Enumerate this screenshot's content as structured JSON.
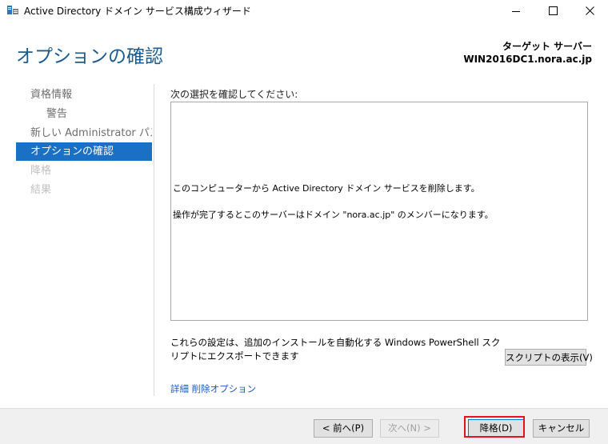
{
  "window": {
    "title": "Active Directory ドメイン サービス構成ウィザード",
    "icon": "server-wizard-icon",
    "minimize_icon": "minimize-icon",
    "maximize_icon": "maximize-icon",
    "close_icon": "close-icon"
  },
  "header": {
    "page_title": "オプションの確認",
    "target_label": "ターゲット サーバー",
    "target_server": "WIN2016DC1.nora.ac.jp"
  },
  "sidebar": {
    "items": [
      {
        "label": "資格情報",
        "state": "normal"
      },
      {
        "label": "警告",
        "state": "normal"
      },
      {
        "label": "新しい Administrator パス...",
        "state": "normal"
      },
      {
        "label": "オプションの確認",
        "state": "active"
      },
      {
        "label": "降格",
        "state": "disabled"
      },
      {
        "label": "結果",
        "state": "disabled"
      }
    ]
  },
  "main": {
    "review_label": "次の選択を確認してください:",
    "summary_lines": [
      "このコンピューターから Active Directory ドメイン サービスを削除します。",
      "操作が完了するとこのサーバーはドメイン \"nora.ac.jp\" のメンバーになります。"
    ],
    "powershell_note": "これらの設定は、追加のインストールを自動化する Windows PowerShell スクリプトにエクスポートできます",
    "view_script_button": "スクリプトの表示(V)",
    "details_link": "詳細 削除オプション"
  },
  "footer": {
    "prev_button": "< 前へ(P)",
    "next_button": "次へ(N) >",
    "demote_button": "降格(D)",
    "cancel_button": "キャンセル"
  },
  "colors": {
    "title_blue": "#1a5b8f",
    "active_nav": "#1a70c4",
    "link": "#1a5bc4",
    "highlight": "#e8111b"
  }
}
